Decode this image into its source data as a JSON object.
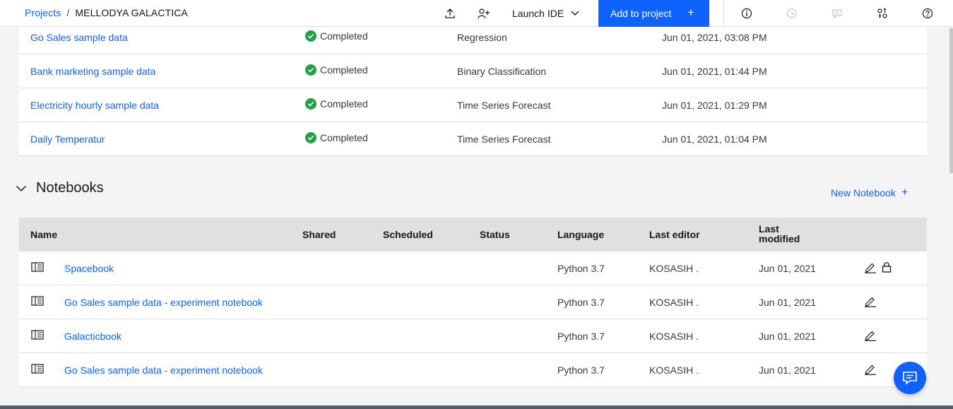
{
  "header": {
    "breadcrumb_root": "Projects",
    "breadcrumb_separator": "/",
    "breadcrumb_current": "MELLODYA GALACTICA",
    "launch_ide_label": "Launch IDE",
    "add_to_project_label": "Add to project",
    "add_to_project_plus": "+"
  },
  "experiments": [
    {
      "name": "Go Sales sample data",
      "status": "Completed",
      "type": "Regression",
      "date": "Jun 01, 2021, 03:08 PM"
    },
    {
      "name": "Bank marketing sample data",
      "status": "Completed",
      "type": "Binary Classification",
      "date": "Jun 01, 2021, 01:44 PM"
    },
    {
      "name": "Electricity hourly sample data",
      "status": "Completed",
      "type": "Time Series Forecast",
      "date": "Jun 01, 2021, 01:29 PM"
    },
    {
      "name": "Daily Temperatur",
      "status": "Completed",
      "type": "Time Series Forecast",
      "date": "Jun 01, 2021, 01:04 PM"
    }
  ],
  "notebooks": {
    "section_title": "Notebooks",
    "new_notebook_label": "New Notebook",
    "new_notebook_plus": "+",
    "columns": {
      "name": "Name",
      "shared": "Shared",
      "scheduled": "Scheduled",
      "status": "Status",
      "language": "Language",
      "last_editor": "Last editor",
      "last_modified_line1": "Last",
      "last_modified_line2": "modified"
    },
    "rows": [
      {
        "name": "Spacebook",
        "language": "Python 3.7",
        "editor": "KOSASIH .",
        "modified": "Jun 01, 2021"
      },
      {
        "name": "Go Sales sample data - experiment notebook",
        "language": "Python 3.7",
        "editor": "KOSASIH .",
        "modified": "Jun 01, 2021"
      },
      {
        "name": "Galacticbook",
        "language": "Python 3.7",
        "editor": "KOSASIH .",
        "modified": "Jun 01, 2021"
      },
      {
        "name": "Go Sales sample data - experiment notebook",
        "language": "Python 3.7",
        "editor": "KOSASIH .",
        "modified": "Jun 01, 2021"
      }
    ]
  },
  "colors": {
    "accent": "#0f62fe",
    "success": "#24a148",
    "header_bg": "#ffffff",
    "table_header_bg": "#e0e0e0",
    "page_bg": "#f4f4f4"
  },
  "icons": [
    "upload-icon",
    "add-collaborator-icon",
    "chevron-down-icon",
    "info-icon",
    "history-icon",
    "comment-icon",
    "settings-adjust-icon",
    "help-icon",
    "checkmark-filled-icon",
    "notebook-icon",
    "edit-icon",
    "lock-icon",
    "chat-icon"
  ]
}
